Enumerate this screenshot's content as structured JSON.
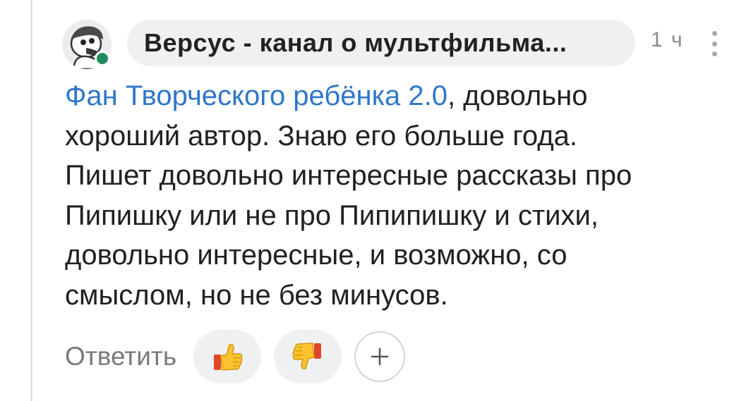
{
  "comment": {
    "author": "Версус - канал о мультфильма...",
    "time": "1 ч",
    "online": true,
    "mention": "Фан Творческого ребёнка 2.0",
    "line1_rest": ", довольно",
    "line2": "хороший автор. Знаю его больше года.",
    "line3": "Пишет довольно интересные рассказы про",
    "line4": "Пипишку или не про Пипипишку и стихи,",
    "line5": "довольно интересные, и возможно, со",
    "line6": "смыслом, но не без минусов."
  },
  "actions": {
    "reply_label": "Ответить",
    "like_icon": "thumbs-up-icon",
    "dislike_icon": "thumbs-down-icon",
    "add_reaction_icon": "plus-icon"
  },
  "colors": {
    "mention": "#2f77c9",
    "online": "#1e8c5a",
    "pill_background": "#eff0f2"
  }
}
